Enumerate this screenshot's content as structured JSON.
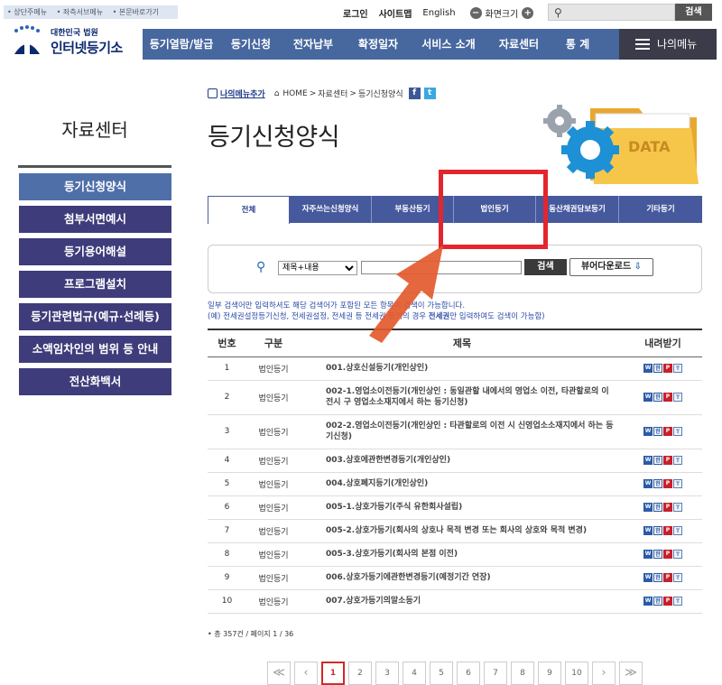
{
  "skip_links": [
    "상단주메뉴",
    "좌측서브메뉴",
    "본문바로가기"
  ],
  "util": {
    "login": "로그인",
    "sitemap": "사이트맵",
    "english": "English",
    "zoom_label": "화면크기",
    "zoom_minus": "−",
    "zoom_plus": "+",
    "search_button": "검색"
  },
  "logo": {
    "sub": "대한민국 법원",
    "main": "인터넷등기소"
  },
  "gnb": [
    "등기열람/발급",
    "등기신청",
    "전자납부",
    "확정일자",
    "서비스 소개",
    "자료센터",
    "통 계"
  ],
  "mymenu": "나의메뉴",
  "sidebar": {
    "title": "자료센터",
    "items": [
      "등기신청양식",
      "첨부서면예시",
      "등기용어해설",
      "프로그램설치",
      "등기관련법규(예규·선례등)",
      "소액임차인의 범위 등 안내",
      "전산화백서"
    ]
  },
  "breadcrumb": {
    "add": "나의메뉴추가",
    "home": "HOME",
    "sep1": ">",
    "section": "자료센터",
    "sep2": ">",
    "current": "등기신청양식",
    "fb": "f",
    "tw": "t"
  },
  "page_title": "등기신청양식",
  "illustration_label": "DATA",
  "tabs": [
    "전체",
    "자주쓰는신청양식",
    "부동산등기",
    "법인등기",
    "동산채권담보등기",
    "기타등기"
  ],
  "search": {
    "select_value": "제목+내용",
    "button": "검색",
    "viewer": "뷰어다운로드",
    "viewer_icon": "⇩"
  },
  "notes": {
    "line1": "일부 검색어만 입력하셔도 해당 검색어가 포함된 모든 항목이 검색이 가능합니다.",
    "line2_pre": "(예) 전세권설정등기신청, 전세권설정, 전세권 등 전세권 등기의 경우 ",
    "line2_bold": "전세권",
    "line2_post": "만 입력하여도 검색이 가능함)"
  },
  "table": {
    "headers": [
      "번호",
      "구분",
      "제목",
      "내려받기"
    ],
    "rows": [
      {
        "no": "1",
        "cat": "법인등기",
        "title": "001.상호신설등기(개인상인)"
      },
      {
        "no": "2",
        "cat": "법인등기",
        "title": "002-1.영업소이전등기(개인상인 : 동일관할 내에서의 영업소 이전, 타관할로의 이 전시 구 영업소소재지에서 하는 등기신청)"
      },
      {
        "no": "3",
        "cat": "법인등기",
        "title": "002-2.영업소이전등기(개인상인 : 타관할로의 이전 시 신영업소소재지에서 하는 등기신청)"
      },
      {
        "no": "4",
        "cat": "법인등기",
        "title": "003.상호에관한변경등기(개인상인)"
      },
      {
        "no": "5",
        "cat": "법인등기",
        "title": "004.상호폐지등기(개인상인)"
      },
      {
        "no": "6",
        "cat": "법인등기",
        "title": "005-1.상호가등기(주식 유한회사설립)"
      },
      {
        "no": "7",
        "cat": "법인등기",
        "title": "005-2.상호가등기(회사의 상호나 목적 변경 또는 회사의 상호와 목적 변경)"
      },
      {
        "no": "8",
        "cat": "법인등기",
        "title": "005-3.상호가등기(회사의 본점 이전)"
      },
      {
        "no": "9",
        "cat": "법인등기",
        "title": "006.상호가등기에관한변경등기(예정기간 연장)"
      },
      {
        "no": "10",
        "cat": "법인등기",
        "title": "007.상호가등기의말소등기"
      }
    ],
    "download_icons": [
      "W",
      "한",
      "P",
      "T"
    ]
  },
  "total": "총 357건 / 페이지 1 / 36",
  "pager": {
    "first": "≪",
    "prev": "‹",
    "pages": [
      "1",
      "2",
      "3",
      "4",
      "5",
      "6",
      "7",
      "8",
      "9",
      "10"
    ],
    "next": "›",
    "last": "≫"
  },
  "colors": {
    "gnb": "#47679f",
    "sidebar": "#3e3c7a",
    "sidebar_active": "#4f6fa9",
    "tab": "#46599d",
    "highlight": "#e3262e",
    "arrow": "#e35a2c"
  }
}
